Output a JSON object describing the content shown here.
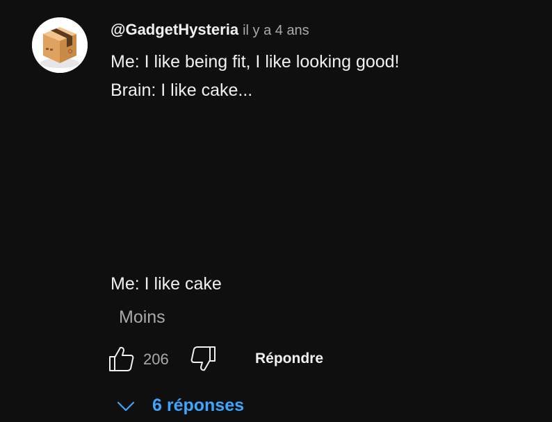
{
  "comment": {
    "author": "@GadgetHysteria",
    "time": "il y a 4 ans",
    "lines": [
      "Me: I like being fit, I like looking good!",
      "Brain: I like cake...",
      "Me: I like cake"
    ],
    "less_label": "Moins",
    "like_count": "206",
    "reply_label": "Répondre",
    "replies_label": "6 réponses",
    "avatar_icon": "cardboard-box-icon"
  },
  "colors": {
    "background": "#0f0f0f",
    "text": "#f1f1f1",
    "muted": "#aaaaaa",
    "link": "#3ea6ff"
  }
}
